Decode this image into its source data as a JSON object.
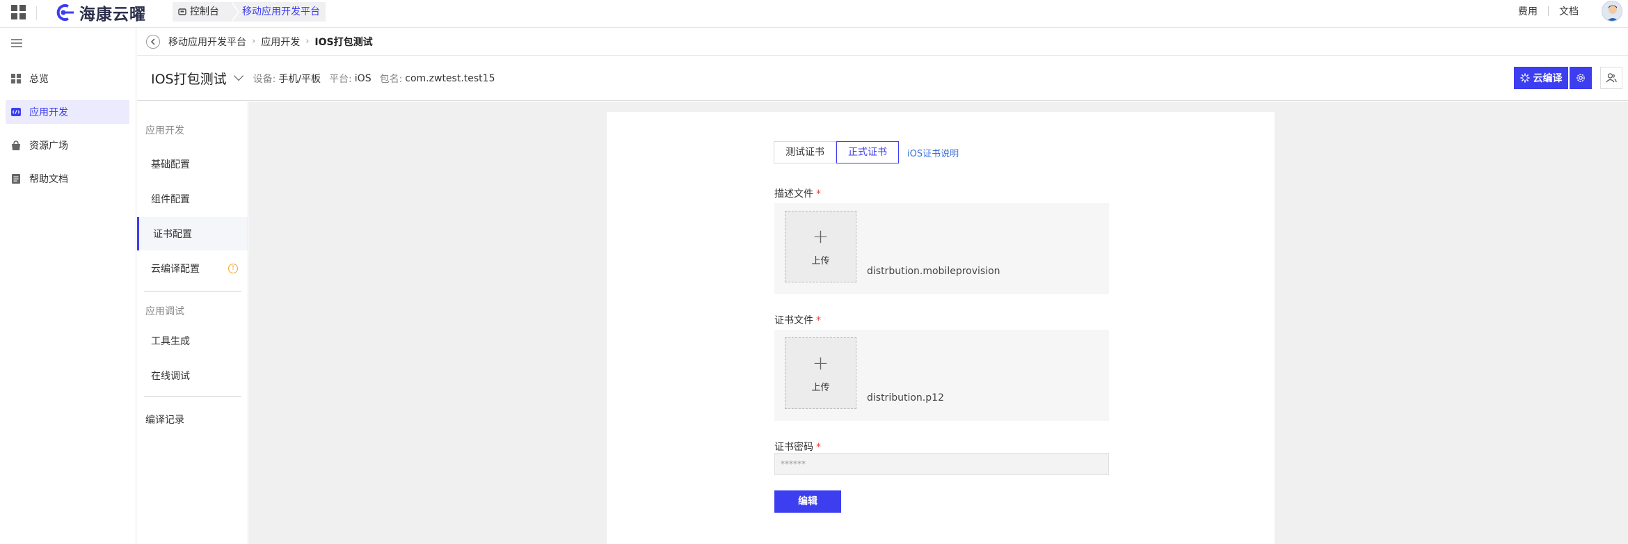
{
  "topbar": {
    "brand": "海康云曜",
    "tabs": [
      "控制台",
      "移动应用开发平台"
    ],
    "links": [
      "费用",
      "文档"
    ]
  },
  "leftnav": {
    "items": [
      {
        "label": "总览",
        "icon": "dashboard-icon"
      },
      {
        "label": "应用开发",
        "icon": "code-icon"
      },
      {
        "label": "资源广场",
        "icon": "bag-icon"
      },
      {
        "label": "帮助文档",
        "icon": "document-icon"
      }
    ]
  },
  "breadcrumb": {
    "items": [
      "移动应用开发平台",
      "应用开发"
    ],
    "current": "IOS打包测试"
  },
  "project": {
    "title": "IOS打包测试",
    "device_label": "设备:",
    "device_value": "手机/平板",
    "platform_label": "平台:",
    "platform_value": "iOS",
    "package_label": "包名:",
    "package_value": "com.zwtest.test15",
    "cloud_compile_label": "云编译"
  },
  "subnav": {
    "section1": "应用开发",
    "items1": [
      "基础配置",
      "组件配置",
      "证书配置",
      "云编译配置"
    ],
    "section2": "应用调试",
    "items2": [
      "工具生成",
      "在线调试"
    ],
    "extra": "编译记录"
  },
  "form": {
    "tabs": [
      "测试证书",
      "正式证书"
    ],
    "help_link": "iOS证书说明",
    "profile_label": "描述文件",
    "profile_upload": "上传",
    "profile_file": "distrbution.mobileprovision",
    "cert_label": "证书文件",
    "cert_upload": "上传",
    "cert_file": "distribution.p12",
    "password_label": "证书密码",
    "password_value": "******",
    "required_mark": "*",
    "edit_button": "编辑"
  }
}
